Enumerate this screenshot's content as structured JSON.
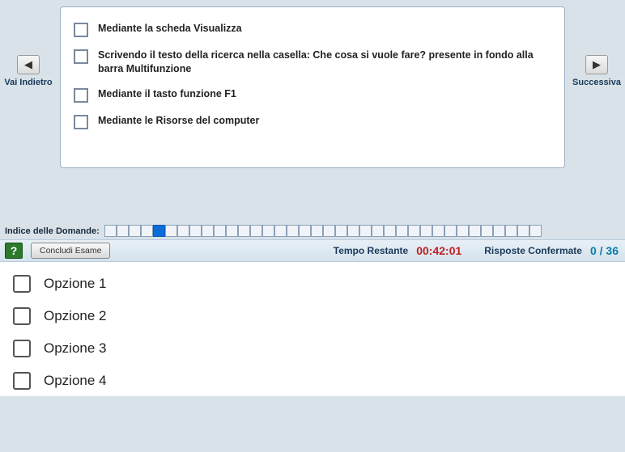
{
  "nav": {
    "prev_label": "Vai Indietro",
    "next_label": "Successiva",
    "prev_glyph": "◀",
    "next_glyph": "▶"
  },
  "answers": [
    "Mediante la scheda Visualizza",
    "Scrivendo il testo della ricerca nella casella: Che cosa si vuole fare? presente in fondo alla barra Multifunzione",
    "Mediante il tasto funzione F1",
    "Mediante le Risorse del computer"
  ],
  "index": {
    "label": "Indice delle Domande:",
    "total": 36,
    "current": 5
  },
  "status": {
    "help_glyph": "?",
    "conclude_label": "Concludi Esame",
    "time_label": "Tempo Restante",
    "time_value": "00:42:01",
    "confirmed_label": "Risposte Confermate",
    "confirmed_value": "0 / 36"
  },
  "options": [
    "Opzione 1",
    "Opzione 2",
    "Opzione 3",
    "Opzione 4"
  ]
}
